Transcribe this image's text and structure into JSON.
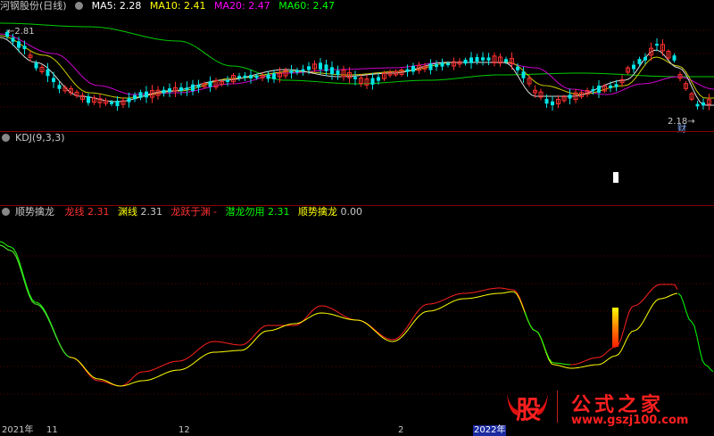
{
  "main": {
    "title": "河钢股份(日线)",
    "ma": [
      {
        "label": "MA5:",
        "value": "2.28",
        "color": "#ffffff"
      },
      {
        "label": "MA10:",
        "value": "2.41",
        "color": "#ffff00"
      },
      {
        "label": "MA20:",
        "value": "2.47",
        "color": "#ff00ff"
      },
      {
        "label": "MA60:",
        "value": "2.47",
        "color": "#00ff00"
      }
    ],
    "high_label": "2.81",
    "low_label": "2.18",
    "cai_label": "财"
  },
  "kdj": {
    "title": "KDJ(9,3,3)"
  },
  "indicator": {
    "title": "顺势擒龙",
    "lines": [
      {
        "label": "龙线",
        "value": "2.31",
        "color": "#ff3030"
      },
      {
        "label": "渊线",
        "value": "2.31",
        "color": "#ffff00"
      },
      {
        "label": "龙跃于渊 -",
        "value": "",
        "color": "#ff3030"
      },
      {
        "label": "潜龙勿用",
        "value": "2.31",
        "color": "#00ff00"
      },
      {
        "label": "顺势擒龙",
        "value": "0.00",
        "color": "#ffff00"
      }
    ]
  },
  "axis": {
    "labels": [
      "2021年",
      "11",
      "12",
      "2",
      "2022年"
    ]
  },
  "watermark": {
    "big": "股",
    "text": "公式之家",
    "url": "www.gszj100.com"
  }
}
